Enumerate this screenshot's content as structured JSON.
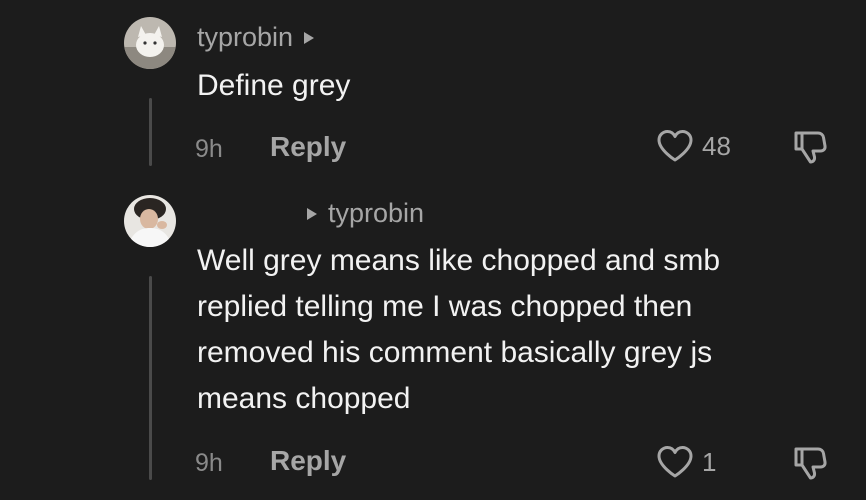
{
  "comments": [
    {
      "username": "typrobin",
      "reply_to": "",
      "text": "Define grey",
      "time": "9h",
      "reply_label": "Reply",
      "likes": "48"
    },
    {
      "username": "",
      "reply_to": "typrobin",
      "text": "Well grey means like chopped and smb\nreplied telling me I was chopped then\nremoved his comment basically grey js\nmeans chopped",
      "time": "9h",
      "reply_label": "Reply",
      "likes": "1"
    }
  ],
  "colors": {
    "background": "#1c1c1c",
    "text": "#f2f2f2",
    "muted": "#a6a6a6"
  }
}
